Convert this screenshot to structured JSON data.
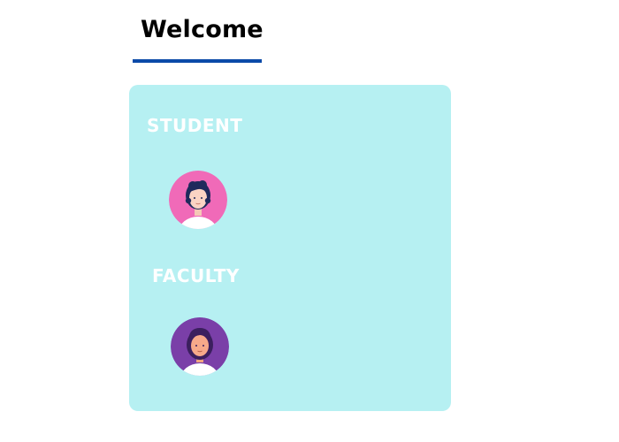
{
  "header": {
    "title": "Welcome"
  },
  "colors": {
    "underline": "#0b4aa8",
    "card_background": "#b6f0f2",
    "student_avatar_bg": "#f06ab8",
    "faculty_avatar_bg": "#7a3fa8"
  },
  "roles": {
    "student": {
      "label": "STUDENT",
      "icon": "student-avatar-icon"
    },
    "faculty": {
      "label": "FACULTY",
      "icon": "faculty-avatar-icon"
    }
  }
}
